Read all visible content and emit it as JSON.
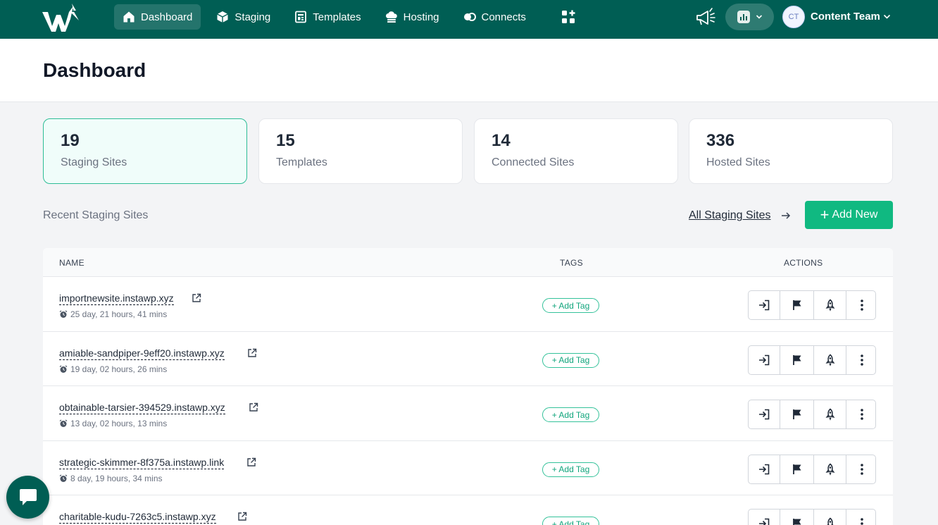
{
  "nav": {
    "items": [
      {
        "label": "Dashboard",
        "icon": "home-icon",
        "active": true
      },
      {
        "label": "Staging",
        "icon": "cube-icon",
        "active": false
      },
      {
        "label": "Templates",
        "icon": "templates-icon",
        "active": false
      },
      {
        "label": "Hosting",
        "icon": "cloud-server-icon",
        "active": false
      },
      {
        "label": "Connects",
        "icon": "connects-icon",
        "active": false
      }
    ],
    "apps_icon": "apps-grid-icon",
    "announcement_icon": "megaphone-icon"
  },
  "user": {
    "initials": "CT",
    "team": "Content Team"
  },
  "page": {
    "title": "Dashboard"
  },
  "stats": [
    {
      "value": "19",
      "label": "Staging Sites"
    },
    {
      "value": "15",
      "label": "Templates"
    },
    {
      "value": "14",
      "label": "Connected Sites"
    },
    {
      "value": "336",
      "label": "Hosted Sites"
    }
  ],
  "recent": {
    "title": "Recent Staging Sites",
    "all_link": "All Staging Sites",
    "add_new_plus": "+",
    "add_new": "Add New"
  },
  "table": {
    "headers": {
      "name": "NAME",
      "tags": "TAGS",
      "actions": "ACTIONS"
    },
    "add_tag_label": "+ Add Tag",
    "rows": [
      {
        "name": "importnewsite.instawp.xyz",
        "age": "25 day, 21 hours, 41 mins"
      },
      {
        "name": "amiable-sandpiper-9eff20.instawp.xyz",
        "age": "19 day, 02 hours, 26 mins"
      },
      {
        "name": "obtainable-tarsier-394529.instawp.xyz",
        "age": "13 day, 02 hours, 13 mins"
      },
      {
        "name": "strategic-skimmer-8f375a.instawp.link",
        "age": "8 day, 19 hours, 34 mins"
      },
      {
        "name": "charitable-kudu-7263c5.instawp.xyz",
        "age": ""
      }
    ]
  },
  "colors": {
    "topbar": "#005e54",
    "accent": "#10b981",
    "active_card_bg": "#f0fdfa",
    "active_card_border": "#2dbd96"
  }
}
